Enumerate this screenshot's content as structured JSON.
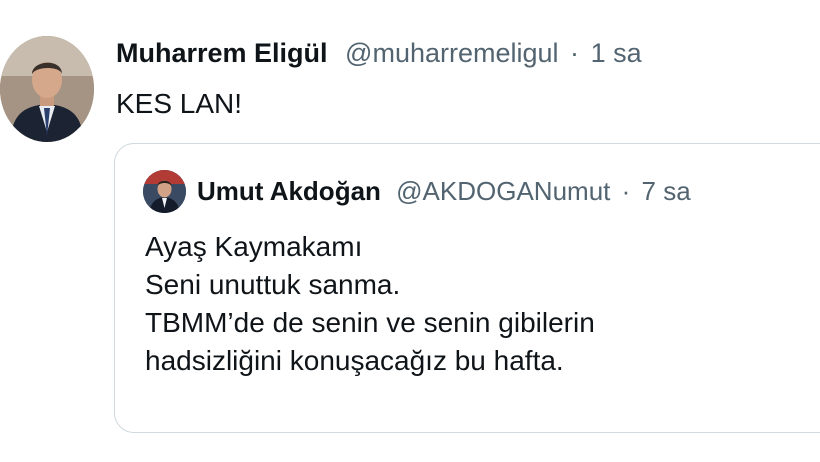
{
  "tweet": {
    "author": {
      "name": "Muharrem Eligül",
      "handle": "@muharremeligul",
      "separator": "·",
      "time": "1 sa"
    },
    "text": "KES LAN!",
    "quoted": {
      "author": {
        "name": "Umut Akdoğan",
        "handle": "@AKDOGANumut",
        "separator": "·",
        "time": "7 sa"
      },
      "lines": [
        "Ayaş Kaymakamı",
        "Seni unuttuk sanma.",
        "TBMM’de de senin ve senin gibilerin",
        "hadsizliğini konuşacağız bu hafta."
      ]
    }
  },
  "colors": {
    "text_primary": "#0f1419",
    "text_secondary": "#536471",
    "border": "#cfd9de"
  },
  "icons": [
    "avatar-muharrem-eligul",
    "avatar-umut-akdogan"
  ]
}
